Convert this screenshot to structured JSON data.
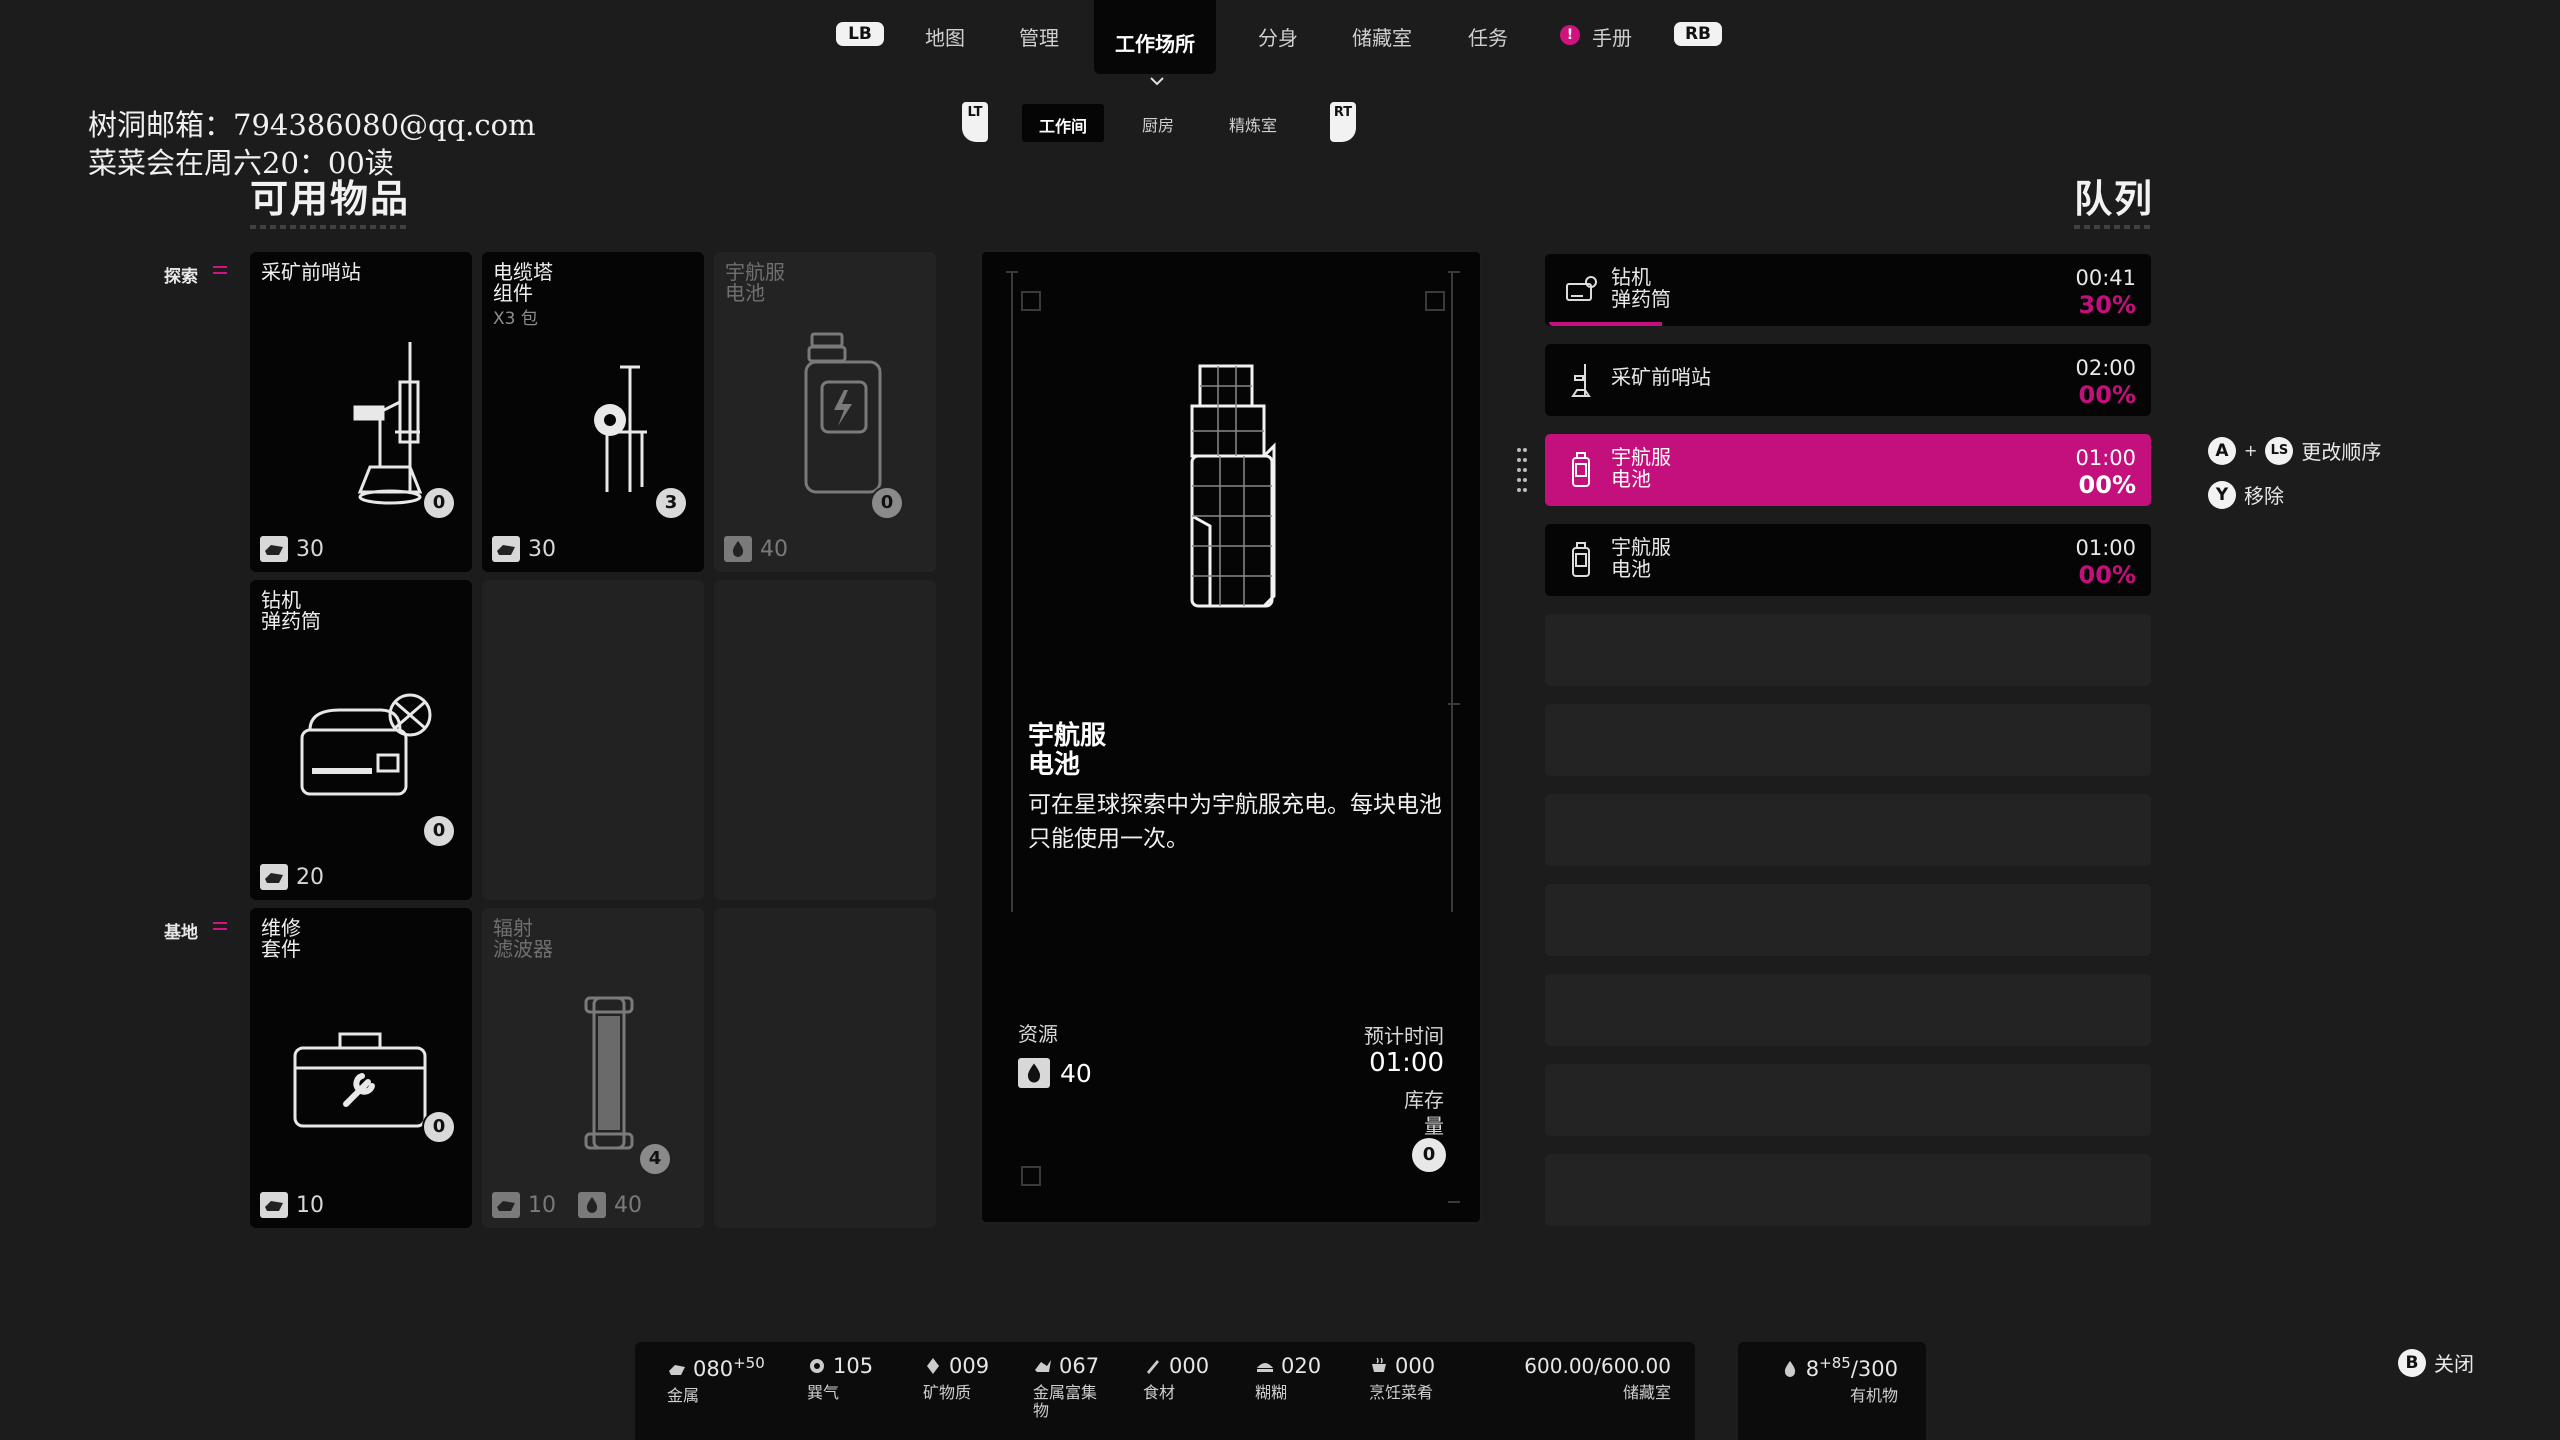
{
  "topnav": {
    "lb": "LB",
    "rb": "RB",
    "tabs": [
      "地图",
      "管理",
      "工作场所",
      "分身",
      "储藏室",
      "任务",
      "手册"
    ],
    "alert_glyph": "!"
  },
  "subnav": {
    "lt": "LT",
    "rt": "RT",
    "tabs": [
      "工作间",
      "厨房",
      "精炼室"
    ]
  },
  "watermark": {
    "line1": "树洞邮箱：794386080@qq.com",
    "line2": "菜菜会在周六20：00读"
  },
  "available": {
    "title": "可用物品",
    "categories": [
      "探索",
      "基地"
    ],
    "items": [
      {
        "name1": "采矿前哨站",
        "name2": "",
        "sub": "",
        "count": "0",
        "cost1": "30",
        "cost2": ""
      },
      {
        "name1": "电缆塔",
        "name2": "组件",
        "sub": "X3 包",
        "count": "3",
        "cost1": "30",
        "cost2": ""
      },
      {
        "name1": "宇航服",
        "name2": "电池",
        "sub": "",
        "count": "0",
        "cost1": "40",
        "cost2": ""
      },
      {
        "name1": "钻机",
        "name2": "弹药筒",
        "sub": "",
        "count": "0",
        "cost1": "20",
        "cost2": ""
      },
      {
        "name1": "维修",
        "name2": "套件",
        "sub": "",
        "count": "0",
        "cost1": "10",
        "cost2": ""
      },
      {
        "name1": "辐射",
        "name2": "滤波器",
        "sub": "",
        "count": "4",
        "cost1": "10",
        "cost2": "40"
      }
    ]
  },
  "detail": {
    "name1": "宇航服",
    "name2": "电池",
    "desc": "可在星球探索中为宇航服充电。每块电池只能使用一次。",
    "resources_label": "资源",
    "resource_value": "40",
    "time_label": "预计时间",
    "time_value": "01:00",
    "stock_label1": "库存",
    "stock_label2": "量",
    "stock_value": "0"
  },
  "queue": {
    "title": "队列",
    "rows": [
      {
        "name1": "钻机",
        "name2": "弹药筒",
        "time": "00:41",
        "pct": "30%",
        "progress": 0.3
      },
      {
        "name1": "采矿前哨站",
        "name2": "",
        "time": "02:00",
        "pct": "00%",
        "progress": 0
      },
      {
        "name1": "宇航服",
        "name2": "电池",
        "time": "01:00",
        "pct": "00%",
        "progress": 0
      },
      {
        "name1": "宇航服",
        "name2": "电池",
        "time": "01:00",
        "pct": "00%",
        "progress": 0
      }
    ],
    "hint_a": "A",
    "hint_plus": "+",
    "hint_ls": "LS",
    "hint_reorder": "更改顺序",
    "hint_y": "Y",
    "hint_remove": "移除"
  },
  "resources": [
    {
      "value": "080",
      "extra": "+50",
      "label": "金属",
      "icon": "metal-icon"
    },
    {
      "value": "105",
      "extra": "",
      "label": "巽气",
      "icon": "gear-icon"
    },
    {
      "value": "009",
      "extra": "",
      "label": "矿物质",
      "icon": "mineral-icon"
    },
    {
      "value": "067",
      "extra": "",
      "label": "金属富集物",
      "icon": "rich-metal-icon"
    },
    {
      "value": "000",
      "extra": "",
      "label": "食材",
      "icon": "food-icon"
    },
    {
      "value": "020",
      "extra": "",
      "label": "糊糊",
      "icon": "paste-icon"
    },
    {
      "value": "000",
      "extra": "",
      "label": "烹饪菜肴",
      "icon": "dish-icon"
    }
  ],
  "storage": {
    "value": "600.00/600.00",
    "label": "储藏室"
  },
  "organic": {
    "value": "8",
    "extra": "+85",
    "max": "/300",
    "label": "有机物"
  },
  "close": {
    "key": "B",
    "label": "关闭"
  }
}
